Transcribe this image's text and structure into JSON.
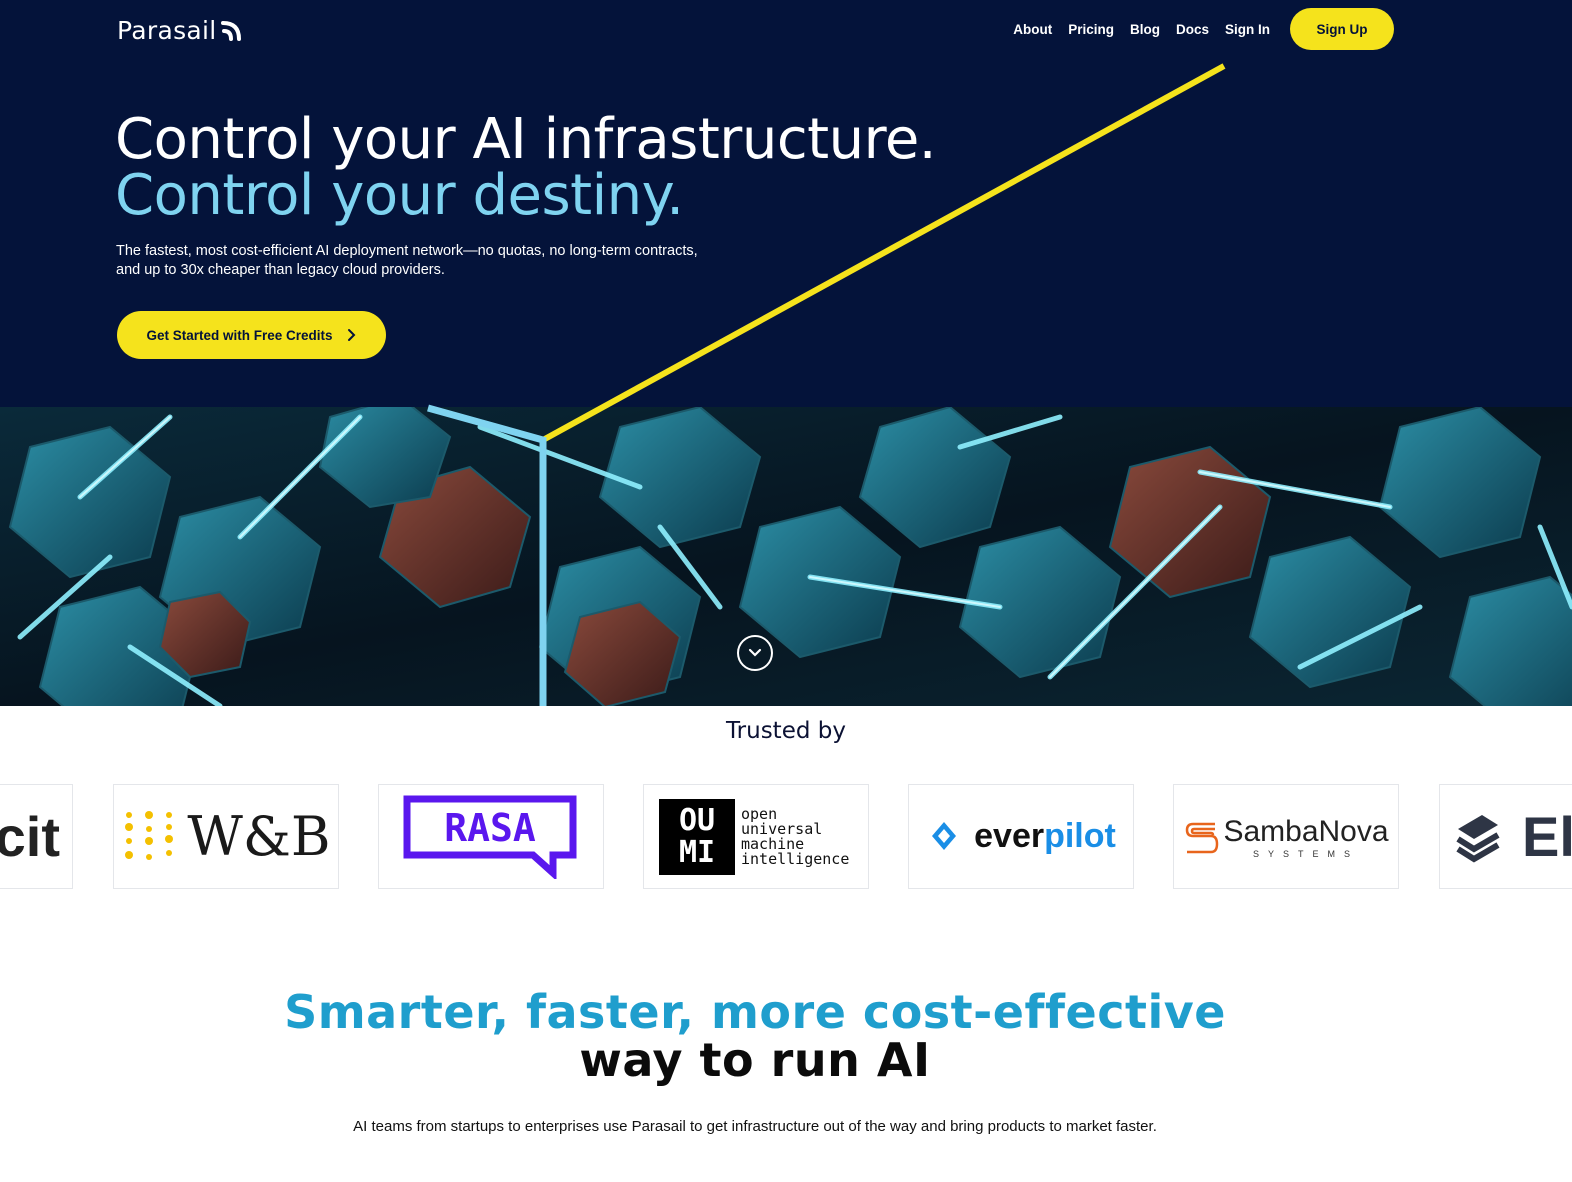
{
  "nav": {
    "logo_text": "Parasail",
    "links": [
      "About",
      "Pricing",
      "Blog",
      "Docs",
      "Sign In"
    ],
    "signup_label": "Sign Up"
  },
  "hero": {
    "title_line1": "Control your AI infrastructure.",
    "title_line2": "Control your destiny.",
    "subtitle": "The fastest, most cost-efficient AI deployment network—no quotas, no long-term contracts, and up to 30x cheaper than legacy cloud providers.",
    "cta_label": "Get Started with Free Credits"
  },
  "trusted": {
    "heading": "Trusted by",
    "logos": [
      {
        "name": "partial-cit",
        "text": "cit"
      },
      {
        "name": "wandb",
        "text": "W&B"
      },
      {
        "name": "rasa",
        "text": "RASA"
      },
      {
        "name": "oumi",
        "text": "open universal machine intelligence"
      },
      {
        "name": "everpilot",
        "text_a": "ever",
        "text_b": "pilot"
      },
      {
        "name": "sambanova",
        "text": "SambaNova",
        "sub": "SYSTEMS"
      },
      {
        "name": "partial-el",
        "text": "El"
      }
    ]
  },
  "section": {
    "heading_line1": "Smarter, faster, more cost-effective",
    "heading_line2": "way to run AI",
    "paragraph": "AI teams from startups to enterprises use Parasail to get infrastructure out of the way and bring products to market faster."
  },
  "colors": {
    "navy": "#04133a",
    "yellow": "#f5e31c",
    "light_blue": "#7fd3f0",
    "accent_blue": "#1f9ecd"
  }
}
